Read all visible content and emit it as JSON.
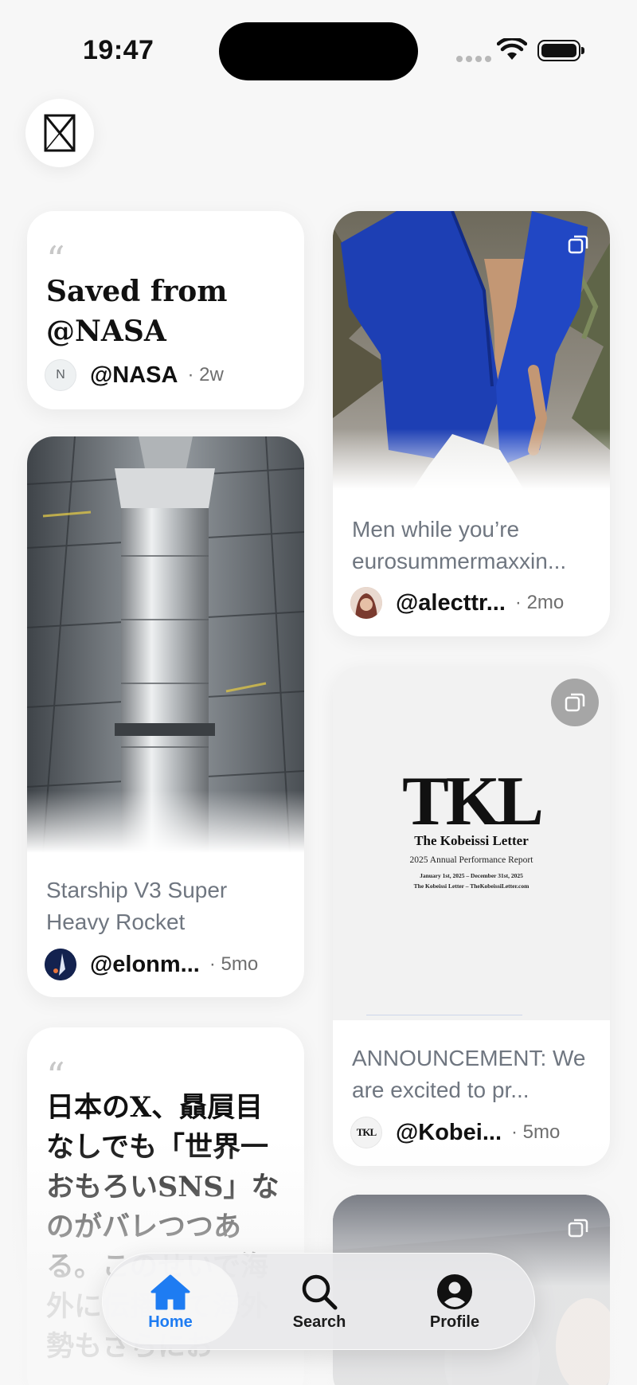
{
  "status_bar": {
    "time": "19:47"
  },
  "logo": {
    "icon": "x-logo-icon"
  },
  "cards": {
    "nasa_quote": {
      "title": "Saved from @NASA",
      "avatar_initial": "N",
      "handle": "@NASA",
      "age": "· 2w"
    },
    "fashion": {
      "description": "Men while you’re eurosummermaxxin...",
      "handle": "@alecttr...",
      "age": "· 2mo"
    },
    "starship": {
      "description": "Starship V3 Super Heavy Rocket",
      "handle": "@elonm...",
      "age": "· 5mo"
    },
    "kobeissi": {
      "logo_text": "TKL",
      "doc_title": "The Kobeissi Letter",
      "doc_subtitle": "2025 Annual Performance Report",
      "doc_dates": "January 1st, 2025 – December 31st, 2025",
      "doc_footer": "The Kobeissi Letter – TheKobeissiLetter.com",
      "avatar_text": "TKL",
      "description": "ANNOUNCEMENT: We are excited to pr...",
      "handle": "@Kobei...",
      "age": "· 5mo"
    },
    "japanese_quote": {
      "title": "日本のX、贔屓目なしでも「世界一おもろいSNS」なのがバレつつある。このせいで海外に伝播して海外勢もさらにお"
    }
  },
  "nav": {
    "home_label": "Home",
    "search_label": "Search",
    "profile_label": "Profile"
  },
  "colors": {
    "accent": "#1e7cf2",
    "background": "#f7f7f7"
  }
}
